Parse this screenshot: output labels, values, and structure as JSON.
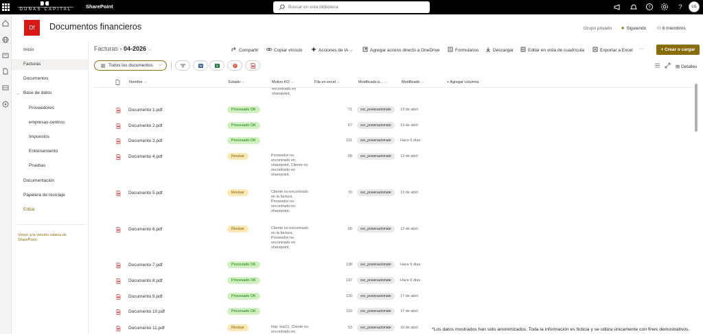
{
  "suite": {
    "brand_text": "DUNAS CAPITAL",
    "app_name": "SharePoint",
    "search_placeholder": "Buscar en esta biblioteca",
    "avatar_initials": "LG"
  },
  "site": {
    "logo_initials": "Df",
    "title": "Documentos financieros",
    "privacy": "Grupo privado",
    "follow_label": "Siguiendo",
    "members_label": "8 miembros"
  },
  "nav": {
    "items": [
      "Inicio",
      "Facturas",
      "Documentos",
      "Base de datos",
      "Proveedores",
      "empresas-centros",
      "Impuestos",
      "Entrenamiento",
      "Pruebas",
      "Documentación",
      "Papelera de reciclaje",
      "Editar"
    ],
    "classic_link": "Volver a la versión clásica de SharePoint"
  },
  "breadcrumb": {
    "parent": "Facturas",
    "current": "04-2026"
  },
  "commands": {
    "share": "Compartir",
    "copy_link": "Copiar vínculo",
    "ai_actions": "Acciones de IA",
    "onedrive": "Agregar acceso directo a OneDrive",
    "forms": "Formularios",
    "download": "Descargar",
    "grid_edit": "Editar en vista de cuadrícula",
    "export": "Exportar a Excel",
    "more": "···",
    "create": "+ Crear o cargar"
  },
  "view": {
    "current": "Todos los documentos",
    "details": "Detalles"
  },
  "columns": {
    "name": "Nombre",
    "estado": "Estado",
    "motivo": "Motivo KO",
    "fila": "Fila en excel",
    "modificado_por": "Modificado p...",
    "modificado": "Modificado",
    "add_column": "+ Agregar columna"
  },
  "partial_row_text": "encontrado en sharepoint,",
  "rows": [
    {
      "name": "Documento 1.pdf",
      "estado": "Procesado OK",
      "status": "ok",
      "motivo": "",
      "fila": "71",
      "modified_by": "svc_powerautomate",
      "modified": "13 de abril"
    },
    {
      "name": "Documento 2.pdf",
      "estado": "Procesado OK",
      "status": "ok",
      "motivo": "",
      "fila": "67",
      "modified_by": "svc_powerautomate",
      "modified": "13 de abril"
    },
    {
      "name": "Documento 3.pdf",
      "estado": "Procesado OK",
      "status": "ok",
      "motivo": "",
      "fila": "131",
      "modified_by": "svc_powerautomate",
      "modified": "Hace 6 días"
    },
    {
      "name": "Documento 4.pdf",
      "estado": "Revisar",
      "status": "rev",
      "motivo": "Proveedor no encontrado en sharepoint, Cliente no encontrado en sharepoint,",
      "fila": "68",
      "modified_by": "svc_powerautomate",
      "modified": "13 de abril"
    },
    {
      "name": "Documento 5.pdf",
      "estado": "Revisar",
      "status": "rev",
      "motivo": "Cliente no encontrado en la factura, Proveedor no encontrado en sharepoint,",
      "fila": "70",
      "modified_by": "svc_powerautomate",
      "modified": "13 de abril"
    },
    {
      "name": "Documento 6.pdf",
      "estado": "Revisar",
      "status": "rev",
      "motivo": "Cliente no encontrado en la factura, Proveedor no encontrado en sharepoint,",
      "fila": "69",
      "modified_by": "svc_powerautomate",
      "modified": "13 de abril"
    },
    {
      "name": "Documento 7.pdf",
      "estado": "Procesado OK",
      "status": "ok",
      "motivo": "",
      "fila": "138",
      "modified_by": "svc_powerautomate",
      "modified": "Hace 6 días"
    },
    {
      "name": "Documento 8.pdf",
      "estado": "Procesado OK",
      "status": "ok",
      "motivo": "",
      "fila": "137",
      "modified_by": "svc_powerautomate",
      "modified": "Hace 6 días"
    },
    {
      "name": "Documento 9.pdf",
      "estado": "Procesado OK",
      "status": "ok",
      "motivo": "",
      "fila": "120",
      "modified_by": "svc_powerautomate",
      "modified": "17 de abril"
    },
    {
      "name": "Documento 10.pdf",
      "estado": "Procesado OK",
      "status": "ok",
      "motivo": "",
      "fila": "119",
      "modified_by": "svc_powerautomate",
      "modified": "17 de abril"
    },
    {
      "name": "Documento 11.pdf",
      "estado": "Revisar",
      "status": "rev",
      "motivo": "Imp. Iva(1), Cliente no encontrado en",
      "fila": "53",
      "modified_by": "svc_powerautomate",
      "modified": "10 de abril"
    }
  ],
  "disclaimer": "*Los datos mostrados han sido anonimizados. Toda la información es ficticia y se utiliza únicamente con fines demostrativos.",
  "colors": {
    "accent": "#8a6d0b",
    "ok_bg": "#d0f0c0",
    "rev_bg": "#fde7b4",
    "logo": "#d91717"
  }
}
